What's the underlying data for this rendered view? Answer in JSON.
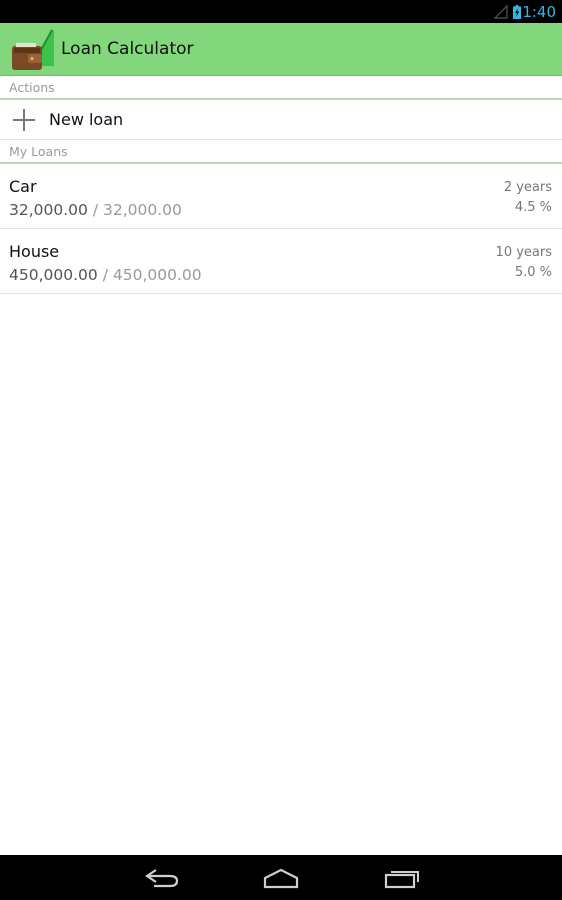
{
  "status_bar": {
    "time": "1:40"
  },
  "app": {
    "title": "Loan Calculator"
  },
  "sections": {
    "actions": "Actions",
    "my_loans": "My Loans"
  },
  "actions": {
    "new_loan": "New loan"
  },
  "loans": [
    {
      "name": "Car",
      "remaining": "32,000.00",
      "separator": "/",
      "total": "32,000.00",
      "term": "2 years",
      "rate": "4.5 %"
    },
    {
      "name": "House",
      "remaining": "450,000.00",
      "separator": "/",
      "total": "450,000.00",
      "term": "10 years",
      "rate": "5.0 %"
    }
  ],
  "colors": {
    "action_bar": "#82d67b",
    "status_accent": "#33b5e5"
  },
  "icons": {
    "app": "wallet-chart-icon",
    "add": "plus-icon",
    "nav": [
      "back-icon",
      "home-icon",
      "recent-apps-icon"
    ]
  }
}
